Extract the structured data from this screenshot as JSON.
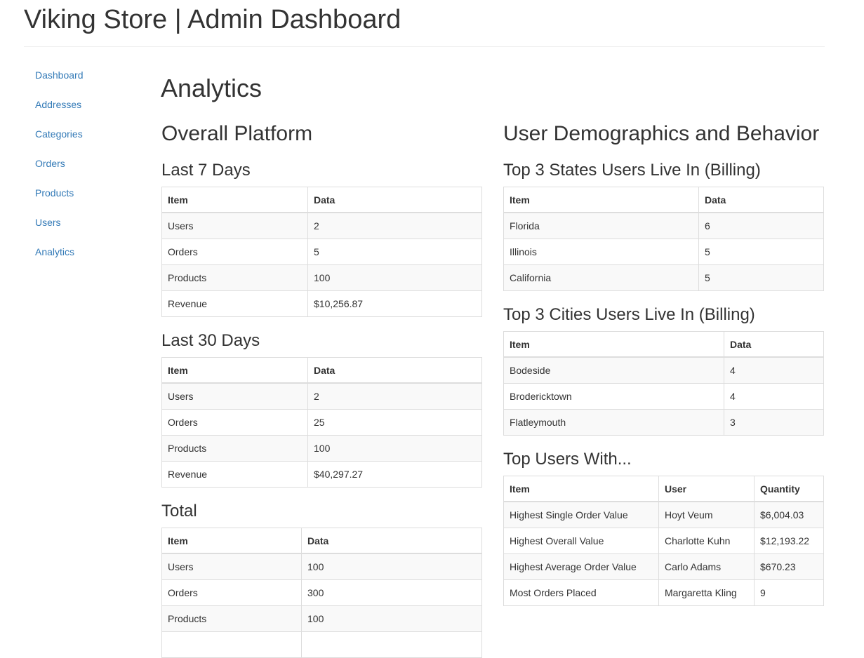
{
  "header": {
    "title": "Viking Store | Admin Dashboard"
  },
  "sidebar": {
    "items": [
      {
        "label": "Dashboard"
      },
      {
        "label": "Addresses"
      },
      {
        "label": "Categories"
      },
      {
        "label": "Orders"
      },
      {
        "label": "Products"
      },
      {
        "label": "Users"
      },
      {
        "label": "Analytics"
      }
    ]
  },
  "main": {
    "title": "Analytics",
    "overall": {
      "title": "Overall Platform",
      "last7": {
        "title": "Last 7 Days",
        "headers": [
          "Item",
          "Data"
        ],
        "rows": [
          [
            "Users",
            "2"
          ],
          [
            "Orders",
            "5"
          ],
          [
            "Products",
            "100"
          ],
          [
            "Revenue",
            "$10,256.87"
          ]
        ]
      },
      "last30": {
        "title": "Last 30 Days",
        "headers": [
          "Item",
          "Data"
        ],
        "rows": [
          [
            "Users",
            "2"
          ],
          [
            "Orders",
            "25"
          ],
          [
            "Products",
            "100"
          ],
          [
            "Revenue",
            "$40,297.27"
          ]
        ]
      },
      "total": {
        "title": "Total",
        "headers": [
          "Item",
          "Data"
        ],
        "rows": [
          [
            "Users",
            "100"
          ],
          [
            "Orders",
            "300"
          ],
          [
            "Products",
            "100"
          ]
        ]
      }
    },
    "demographics": {
      "title": "User Demographics and Behavior",
      "states": {
        "title": "Top 3 States Users Live In (Billing)",
        "headers": [
          "Item",
          "Data"
        ],
        "rows": [
          [
            "Florida",
            "6"
          ],
          [
            "Illinois",
            "5"
          ],
          [
            "California",
            "5"
          ]
        ]
      },
      "cities": {
        "title": "Top 3 Cities Users Live In (Billing)",
        "headers": [
          "Item",
          "Data"
        ],
        "rows": [
          [
            "Bodeside",
            "4"
          ],
          [
            "Brodericktown",
            "4"
          ],
          [
            "Flatleymouth",
            "3"
          ]
        ]
      },
      "top_users": {
        "title": "Top Users With...",
        "headers": [
          "Item",
          "User",
          "Quantity"
        ],
        "rows": [
          [
            "Highest Single Order Value",
            "Hoyt Veum",
            "$6,004.03"
          ],
          [
            "Highest Overall Value",
            "Charlotte Kuhn",
            "$12,193.22"
          ],
          [
            "Highest Average Order Value",
            "Carlo Adams",
            "$670.23"
          ],
          [
            "Most Orders Placed",
            "Margaretta Kling",
            "9"
          ]
        ]
      }
    }
  }
}
